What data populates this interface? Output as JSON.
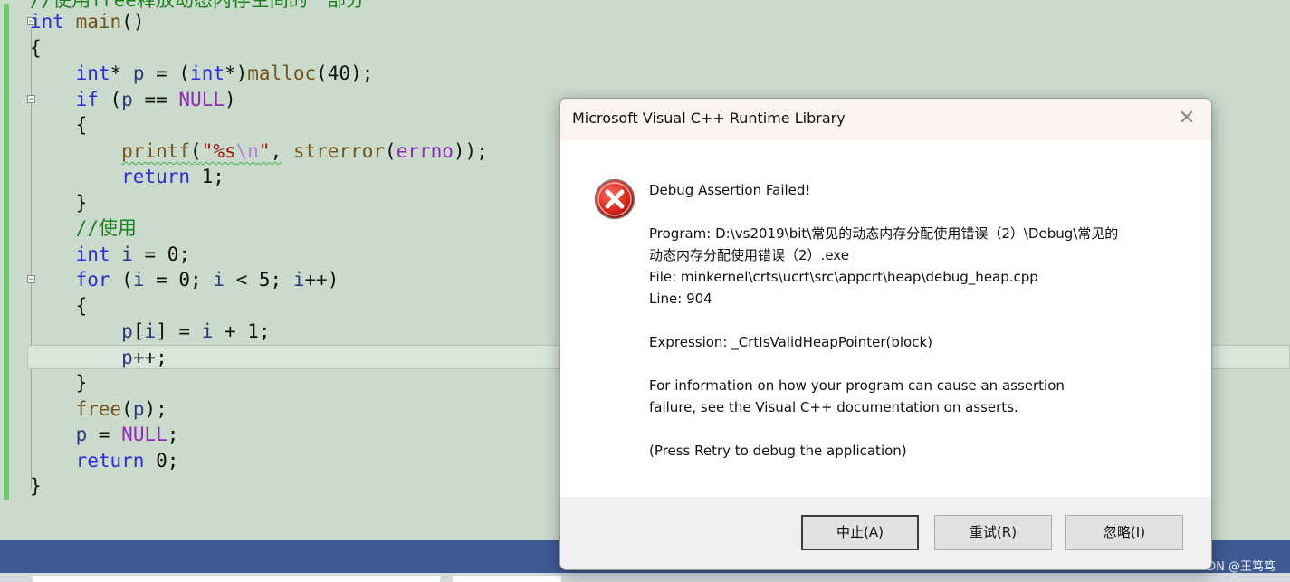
{
  "editor": {
    "lines": [
      "//使用free释放动态内存空间的一部分",
      "int main()",
      "{",
      "    int* p = (int*)malloc(40);",
      "    if (p == NULL)",
      "    {",
      "        printf(\"%s\\n\", strerror(errno));",
      "        return 1;",
      "    }",
      "    //使用",
      "    int i = 0;",
      "    for (i = 0; i < 5; i++)",
      "    {",
      "        p[i] = i + 1;",
      "        p++;",
      "    }",
      "    free(p);",
      "    p = NULL;",
      "    return 0;",
      "}"
    ]
  },
  "dialog": {
    "title": "Microsoft Visual C++ Runtime Library",
    "close_glyph": "✕",
    "icon": "error-icon",
    "heading": "Debug Assertion Failed!",
    "program_line1": "Program: D:\\vs2019\\bit\\常见的动态内存分配使用错误（2）\\Debug\\常见的",
    "program_line2": "动态内存分配使用错误（2）.exe",
    "file_line": "File: minkernel\\crts\\ucrt\\src\\appcrt\\heap\\debug_heap.cpp",
    "line_line": "Line: 904",
    "expression_line": "Expression: _CrtIsValidHeapPointer(block)",
    "info_line1": "For information on how your program can cause an assertion",
    "info_line2": "failure, see the Visual C++ documentation on asserts.",
    "press_retry": "(Press Retry to debug the application)",
    "buttons": {
      "abort": "中止(A)",
      "retry": "重试(R)",
      "ignore": "忽略(I)"
    }
  },
  "watermark": "CSDN @王笃笃",
  "colors": {
    "editor_bg": "#cadbcc",
    "keyword": "#2c2cd8",
    "function": "#74531f",
    "macro": "#8e2ab8",
    "comment": "#18801d",
    "taskbar": "#3e5a94"
  }
}
